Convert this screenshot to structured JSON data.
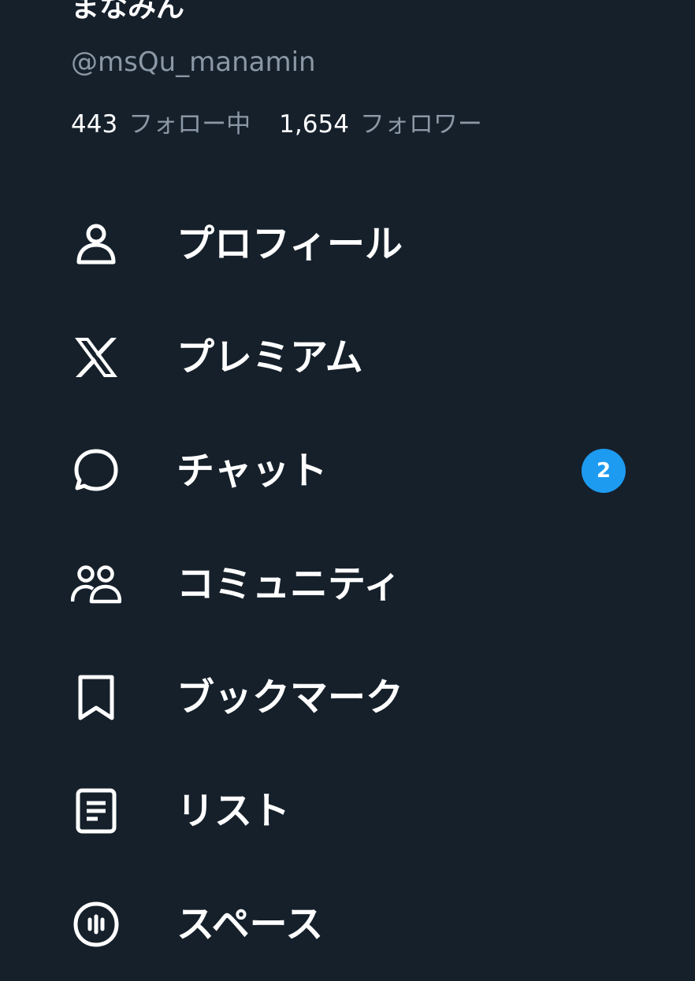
{
  "profile": {
    "display_name": "まなみん",
    "handle": "@msQu_manamin",
    "following_count": "443",
    "following_label": "フォロー中",
    "followers_count": "1,654",
    "followers_label": "フォロワー"
  },
  "menu": {
    "items": [
      {
        "label": "プロフィール",
        "icon": "person-icon"
      },
      {
        "label": "プレミアム",
        "icon": "x-logo-icon"
      },
      {
        "label": "チャット",
        "icon": "chat-bubble-icon",
        "badge": "2"
      },
      {
        "label": "コミュニティ",
        "icon": "communities-icon"
      },
      {
        "label": "ブックマーク",
        "icon": "bookmark-icon"
      },
      {
        "label": "リスト",
        "icon": "list-icon"
      },
      {
        "label": "スペース",
        "icon": "spaces-icon"
      }
    ]
  },
  "colors": {
    "background": "#15202b",
    "text_primary": "#ffffff",
    "text_secondary": "#8b98a5",
    "badge": "#1d9bf0"
  }
}
